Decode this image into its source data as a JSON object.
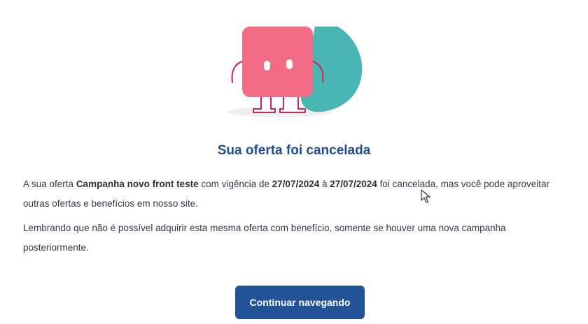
{
  "content": {
    "title": "Sua oferta foi cancelada",
    "paragraph1": {
      "t1": "A sua oferta ",
      "offer_name": "Campanha novo front teste",
      "t2": " com vigência de ",
      "start_date": "27/07/2024",
      "t3": " à ",
      "end_date": "27/07/2024",
      "t4": " foi cancelada, mas você pode aproveitar outras ofertas e benefícios em nosso site."
    },
    "paragraph2": "Lembrando que não é possível adquirir esta mesma oferta com benefício, somente se houver uma nova campanha posteriormente.",
    "button_label": "Continuar navegando"
  },
  "colors": {
    "title": "#1f4f8f",
    "button": "#225397",
    "mascot_pink": "#f26c86",
    "mascot_teal": "#4ab6b3"
  },
  "icons": {
    "illustration": "mascot-illustration",
    "pointer": "mouse-cursor-icon"
  }
}
